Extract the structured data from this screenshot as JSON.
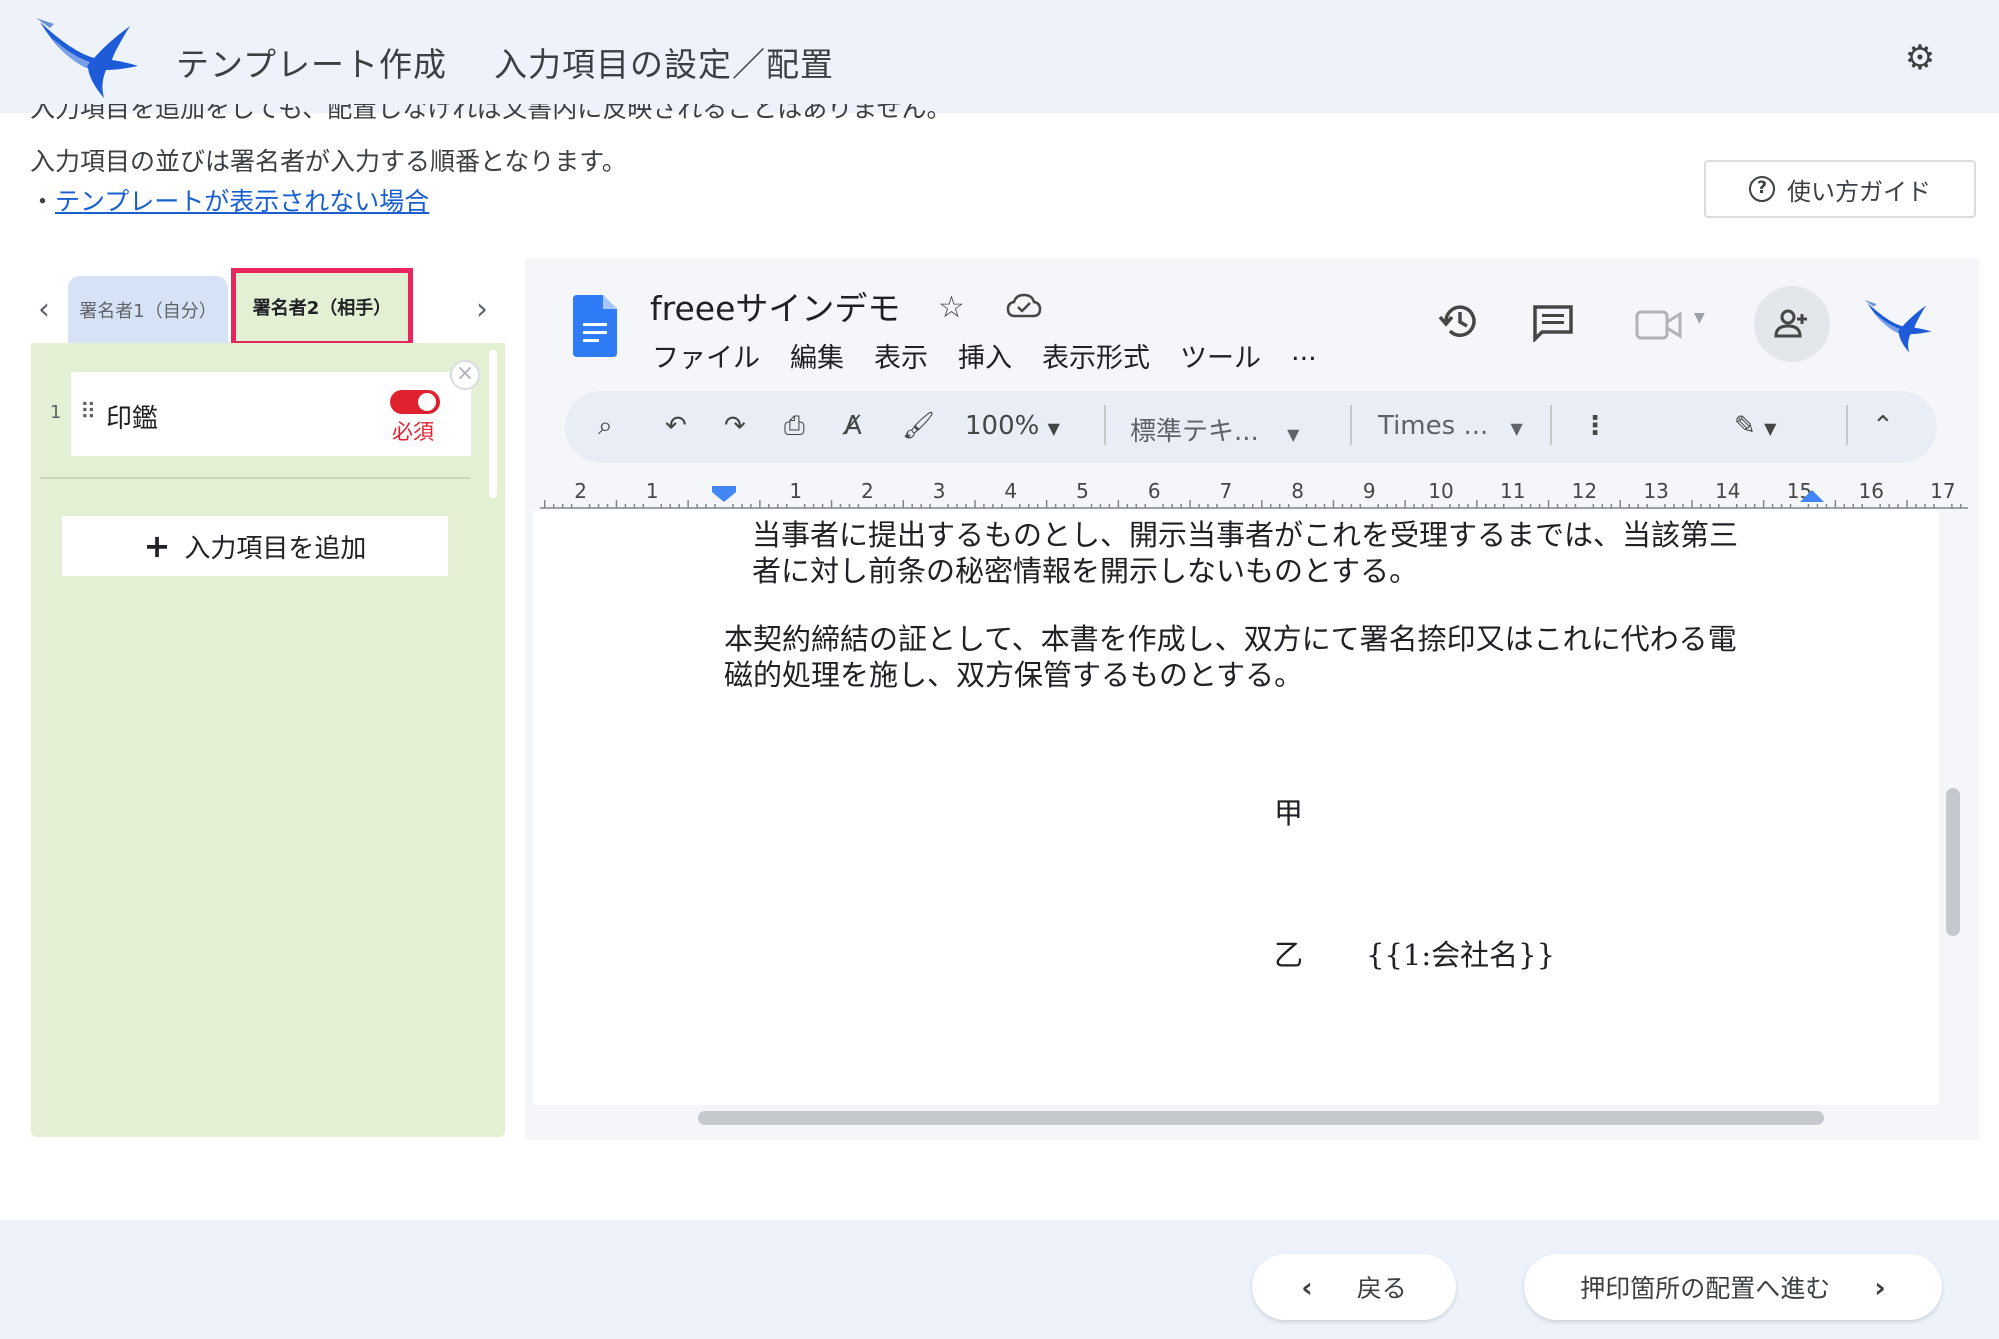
{
  "header": {
    "title": "テンプレート作成",
    "subtitle": "入力項目の設定／配置"
  },
  "instructions": {
    "line1_partial": "入力項目を追加をしても、配置しなければ文書内に反映されることはありません。",
    "line2": "入力項目の並びは署名者が入力する順番となります。",
    "bullet": "・",
    "link": "テンプレートが表示されない場合"
  },
  "guide_button": {
    "label": "使い方ガイド"
  },
  "signer_tabs": {
    "tab1": "署名者1（自分）",
    "tab2": "署名者2（相手）"
  },
  "fields": {
    "items": [
      {
        "number": "1",
        "label": "印鑑",
        "required_label": "必須"
      }
    ],
    "add_label": "入力項目を追加"
  },
  "docs": {
    "title": "freeeサインデモ",
    "menu": [
      "ファイル",
      "編集",
      "表示",
      "挿入",
      "表示形式",
      "ツール",
      "..."
    ],
    "toolbar": {
      "zoom": "100%",
      "style": "標準テキ...",
      "font": "Times ..."
    },
    "ruler_labels": [
      "2",
      "1",
      "1",
      "2",
      "3",
      "4",
      "5",
      "6",
      "7",
      "8",
      "9",
      "10",
      "11",
      "12",
      "13",
      "14",
      "15",
      "16",
      "17"
    ],
    "body": {
      "line1": "当事者に提出するものとし、開示当事者がこれを受理するまでは、当該第三",
      "line2": "者に対し前条の秘密情報を開示しないものとする。",
      "line3": "本契約締結の証として、本書を作成し、双方にて署名捺印又はこれに代わる電",
      "line4": "磁的処理を施し、双方保管するものとする。",
      "party_a": "甲",
      "party_b": "乙",
      "placeholder": "{{1:会社名}}"
    }
  },
  "footer": {
    "back_label": "戻る",
    "next_label": "押印箇所の配置へ進む"
  },
  "colors": {
    "accent_pink": "#e8265e",
    "required_red": "#e0212e",
    "panel_green": "#e4f0d4",
    "link_blue": "#1a5fd0",
    "header_bg": "#eef3fb"
  }
}
